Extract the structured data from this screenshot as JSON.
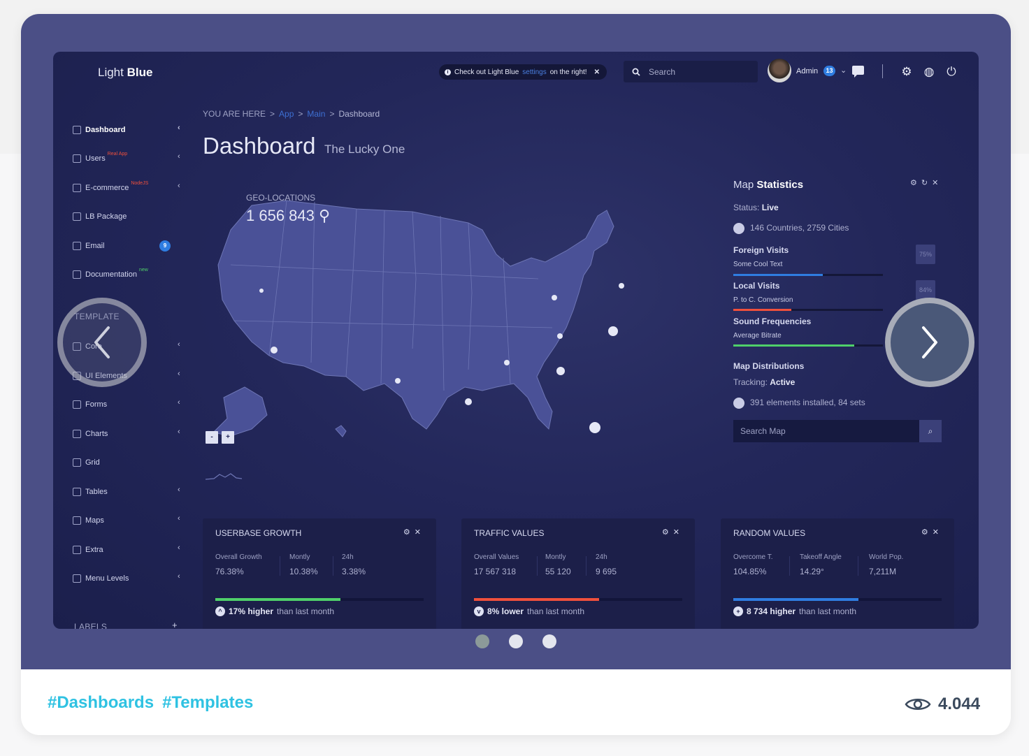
{
  "dashboard": {
    "logo": {
      "light": "Light",
      "bold": "Blue"
    },
    "notice": {
      "pre": "Check out Light Blue",
      "link": "settings",
      "post": "on the right!",
      "close": "✕"
    },
    "search_placeholder": "Search",
    "user": {
      "name": "Admin",
      "badge": "13"
    },
    "sidebar": {
      "items": [
        {
          "label": "Dashboard",
          "tag": "",
          "arrow": "‹"
        },
        {
          "label": "Users",
          "tag": "Real App",
          "arrow": "‹"
        },
        {
          "label": "E-commerce",
          "tag": "NodeJS",
          "arrow": "‹"
        },
        {
          "label": "LB Package",
          "tag": "",
          "arrow": ""
        },
        {
          "label": "Email",
          "badge": "9"
        },
        {
          "label": "Documentation",
          "tag": "new",
          "arrow": ""
        }
      ],
      "template_heading": "TEMPLATE",
      "template_items": [
        {
          "label": "Core",
          "arrow": "‹"
        },
        {
          "label": "UI Elements",
          "arrow": "‹"
        },
        {
          "label": "Forms",
          "arrow": "‹"
        },
        {
          "label": "Charts",
          "arrow": "‹"
        },
        {
          "label": "Grid",
          "arrow": ""
        },
        {
          "label": "Tables",
          "arrow": "‹"
        },
        {
          "label": "Maps",
          "arrow": "‹"
        },
        {
          "label": "Extra",
          "arrow": "‹"
        },
        {
          "label": "Menu Levels",
          "arrow": "‹"
        }
      ],
      "labels_heading": "LABELS",
      "labels_add": "+"
    },
    "breadcrumb": {
      "prefix": "YOU ARE HERE",
      "sep": ">",
      "app": "App",
      "main": "Main",
      "current": "Dashboard"
    },
    "title": "Dashboard",
    "subtitle": "The Lucky One",
    "geo": {
      "label": "GEO-LOCATIONS",
      "value": "1 656 843"
    },
    "zoom": {
      "out": "-",
      "in": "+"
    },
    "map_stats": {
      "title_light": "Map",
      "title_bold": "Statistics",
      "status_label": "Status:",
      "status_value": "Live",
      "countries": "146 Countries, 2759 Cities",
      "rows": [
        {
          "head": "Foreign Visits",
          "sub": "Some Cool Text",
          "pct": "75%",
          "fill": 0.6,
          "color": "#2f7de1"
        },
        {
          "head": "Local Visits",
          "sub": "P. to C. Conversion",
          "pct": "84%",
          "fill": 0.39,
          "color": "#f0503c"
        },
        {
          "head": "Sound Frequencies",
          "sub": "Average Bitrate",
          "pct": "",
          "fill": 0.81,
          "color": "#4fd06a"
        }
      ],
      "distributions": "Map Distributions",
      "tracking_label": "Tracking:",
      "tracking_value": "Active",
      "elements": "391 elements installed, 84 sets",
      "search_placeholder": "Search Map"
    },
    "widgets": [
      {
        "title": "USERBASE GROWTH",
        "cols": [
          {
            "label": "Overall Growth",
            "value": "76.38%"
          },
          {
            "label": "Montly",
            "value": "10.38%"
          },
          {
            "label": "24h",
            "value": "3.38%"
          }
        ],
        "fill": 0.6,
        "color": "#4fd06a",
        "icon": "^",
        "bold": "17% higher",
        "rest": "than last month"
      },
      {
        "title": "TRAFFIC VALUES",
        "cols": [
          {
            "label": "Overall Values",
            "value": "17 567 318"
          },
          {
            "label": "Montly",
            "value": "55 120"
          },
          {
            "label": "24h",
            "value": "9 695"
          }
        ],
        "fill": 0.6,
        "color": "#f0503c",
        "icon": "v",
        "bold": "8% lower",
        "rest": "than last month"
      },
      {
        "title": "RANDOM VALUES",
        "cols": [
          {
            "label": "Overcome T.",
            "value": "104.85%"
          },
          {
            "label": "Takeoff Angle",
            "value": "14.29°"
          },
          {
            "label": "World Pop.",
            "value": "7,211M"
          }
        ],
        "fill": 0.6,
        "color": "#2f7de1",
        "icon": "+",
        "bold": "8 734 higher",
        "rest": "than last month"
      }
    ]
  },
  "carousel": {
    "active_index": 0,
    "count": 3
  },
  "footer": {
    "tags": [
      "#Dashboards",
      "#Templates"
    ],
    "views": "4.044"
  }
}
